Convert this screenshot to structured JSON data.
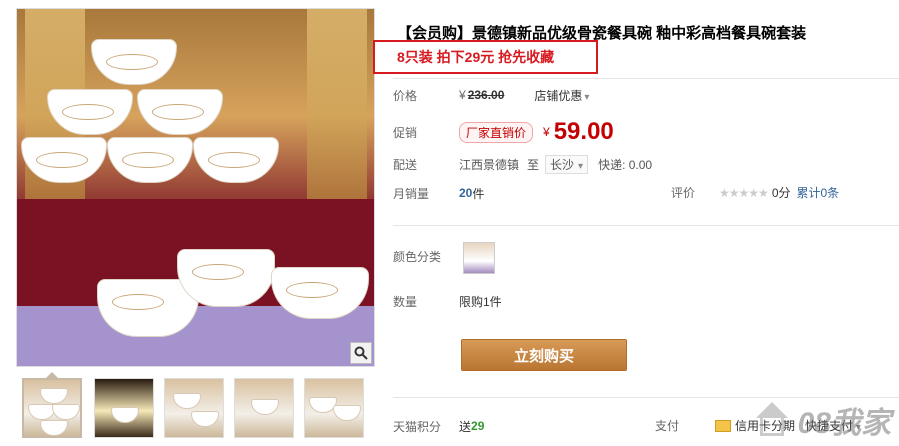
{
  "product": {
    "title": "【会员购】景德镇新品优级骨瓷餐具碗 釉中彩高档餐具碗套装",
    "promo": "8只装 拍下29元 抢先收藏"
  },
  "price": {
    "label": "价格",
    "yen": "¥",
    "original": "236.00",
    "store_deal": "店铺优惠"
  },
  "promotion": {
    "label": "促销",
    "badge": "厂家直销价",
    "yen": "¥",
    "price": "59.00"
  },
  "shipping": {
    "label": "配送",
    "from": "江西景德镇",
    "to_word": "至",
    "destination": "长沙",
    "express": "快递: 0.00"
  },
  "sales": {
    "label": "月销量",
    "count": "20",
    "unit": "件"
  },
  "rating": {
    "label": "评价",
    "stars": "★★★★★",
    "score": "0分",
    "cumulative": "累计0条"
  },
  "color": {
    "label": "颜色分类"
  },
  "quantity": {
    "label": "数量",
    "limit": "限购1件"
  },
  "buy_button": "立刻购买",
  "points": {
    "label": "天猫积分",
    "give": "送",
    "value": "29"
  },
  "payment": {
    "label": "支付",
    "card": "信用卡分期",
    "quick": "快捷支付"
  },
  "watermark": {
    "text": "08我家"
  },
  "icons": {
    "zoom": "magnifier-icon",
    "card": "credit-card-icon",
    "watermark": "house-logo-icon"
  }
}
